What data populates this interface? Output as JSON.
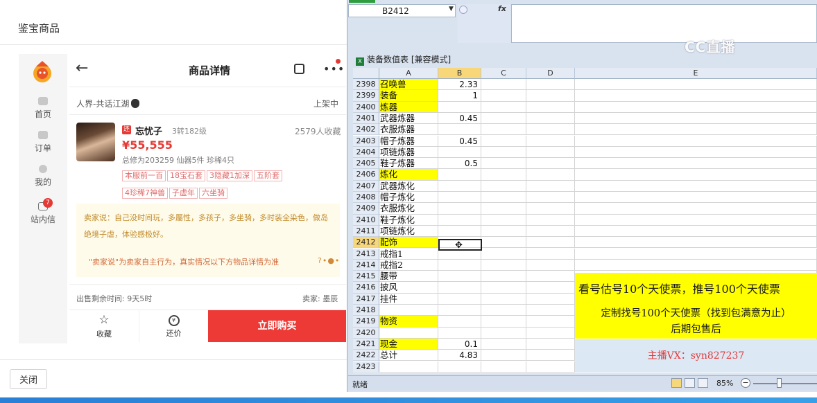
{
  "dialog": {
    "title": "鉴宝商品",
    "close_label": "关闭"
  },
  "nav": {
    "items": [
      {
        "label": "首页"
      },
      {
        "label": "订单"
      },
      {
        "label": "我的"
      },
      {
        "label": "站内信",
        "badge": "7"
      }
    ]
  },
  "detail": {
    "title": "商品详情",
    "server": "人界-共话江湖",
    "status": "上架中",
    "seller_tag": "还",
    "seller_name": "忘忧子",
    "level": "3转182级",
    "favorites": "2579人收藏",
    "price": "¥55,555",
    "stats": "总修为203259  仙器5件  珍稀4只",
    "tags": [
      "本服前一百",
      "18宝石套",
      "3隐藏1加深",
      "五阶套",
      "4珍稀7神兽",
      "子虚年",
      "六坐骑"
    ],
    "seller_say": "卖家说：自己没时间玩，多屬性，多孩子，多坐骑，多时装全染色，做岛绝境子虐，体验感极好。",
    "seller_note": "\"卖家说\"为卖家自主行为，真实情况以下方物品详情为准",
    "remaining": "出售剩余时间: 9天5时",
    "seller_label": "卖家: 墨辰",
    "fav_label": "收藏",
    "haggle_label": "还价",
    "buy_label": "立即购买"
  },
  "excel": {
    "name_box": "B2412",
    "fx": "fx",
    "workbook_title": "装备数值表  [兼容模式]",
    "watermark": "CC直播",
    "columns": [
      "A",
      "B",
      "C",
      "D",
      "E"
    ],
    "rows": [
      {
        "num": "2398",
        "a": "召唤兽",
        "b": "2.33",
        "hl": true
      },
      {
        "num": "2399",
        "a": "装备",
        "b": "1",
        "hl": true
      },
      {
        "num": "2400",
        "a": "炼器",
        "b": "",
        "hl": true
      },
      {
        "num": "2401",
        "a": "武器炼器",
        "b": "0.45",
        "hl": false
      },
      {
        "num": "2402",
        "a": "衣服炼器",
        "b": "",
        "hl": false
      },
      {
        "num": "2403",
        "a": "帽子炼器",
        "b": "0.45",
        "hl": false
      },
      {
        "num": "2404",
        "a": "项链炼器",
        "b": "",
        "hl": false
      },
      {
        "num": "2405",
        "a": "鞋子炼器",
        "b": "0.5",
        "hl": false
      },
      {
        "num": "2406",
        "a": "炼化",
        "b": "",
        "hl": true
      },
      {
        "num": "2407",
        "a": "武器炼化",
        "b": "",
        "hl": false
      },
      {
        "num": "2408",
        "a": "帽子炼化",
        "b": "",
        "hl": false
      },
      {
        "num": "2409",
        "a": "衣服炼化",
        "b": "",
        "hl": false
      },
      {
        "num": "2410",
        "a": "鞋子炼化",
        "b": "",
        "hl": false
      },
      {
        "num": "2411",
        "a": "项链炼化",
        "b": "",
        "hl": false
      },
      {
        "num": "2412",
        "a": "配饰",
        "b": "",
        "hl": true
      },
      {
        "num": "2413",
        "a": "戒指1",
        "b": "",
        "hl": false
      },
      {
        "num": "2414",
        "a": "戒指2",
        "b": "",
        "hl": false
      },
      {
        "num": "2415",
        "a": "腰带",
        "b": "",
        "hl": false
      },
      {
        "num": "2416",
        "a": "披风",
        "b": "",
        "hl": false
      },
      {
        "num": "2417",
        "a": "挂件",
        "b": "",
        "hl": false
      },
      {
        "num": "2418",
        "a": "",
        "b": "",
        "hl": false
      },
      {
        "num": "2419",
        "a": "物资",
        "b": "",
        "hl": true
      },
      {
        "num": "2420",
        "a": "",
        "b": "",
        "hl": false
      },
      {
        "num": "2421",
        "a": "现金",
        "b": "0.1",
        "hl": true
      },
      {
        "num": "2422",
        "a": "总计",
        "b": "4.83",
        "hl": false
      },
      {
        "num": "2423",
        "a": "",
        "b": "",
        "hl": false
      }
    ],
    "banner_1": "看号估号10个天使票，推号100个天使票",
    "banner_2_line1": "定制找号100个天使票（找到包满意为止）",
    "banner_2_line2": "后期包售后",
    "banner_3": "主播VX：syn827237",
    "status_ready": "就绪",
    "zoom": "85%",
    "zoom_minus": "−"
  }
}
